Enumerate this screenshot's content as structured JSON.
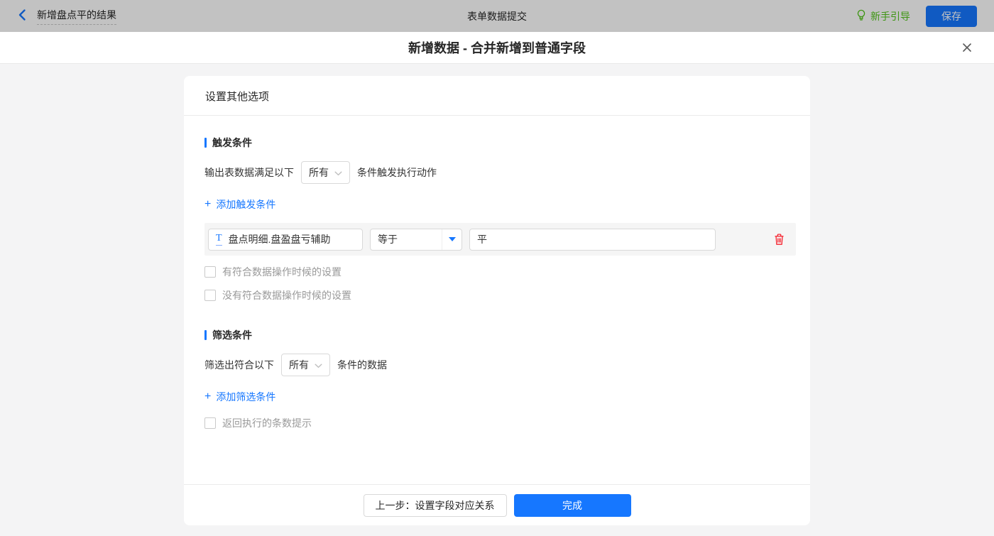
{
  "topbar": {
    "back_title": "新增盘点平的结果",
    "center_title": "表单数据提交",
    "guide_label": "新手引导",
    "save_label": "保存"
  },
  "modal": {
    "title": "新增数据 - 合并新增到普通字段"
  },
  "card": {
    "header_title": "设置其他选项",
    "trigger": {
      "title": "触发条件",
      "sentence_prefix": "输出表数据满足以下",
      "select_value": "所有",
      "sentence_suffix": "条件触发执行动作",
      "add_label": "添加触发条件",
      "condition": {
        "field": "盘点明细.盘盈盘亏辅助",
        "operator": "等于",
        "value": "平"
      },
      "options": [
        "有符合数据操作时候的设置",
        "没有符合数据操作时候的设置"
      ]
    },
    "filter": {
      "title": "筛选条件",
      "sentence_prefix": "筛选出符合以下",
      "select_value": "所有",
      "sentence_suffix": "条件的数据",
      "add_label": "添加筛选条件",
      "option": "返回执行的条数提示"
    }
  },
  "footer": {
    "prev_label": "上一步：设置字段对应关系",
    "done_label": "完成"
  },
  "icons": {
    "plus": "+",
    "text_type": "T"
  },
  "colors": {
    "accent_blue": "#1677ff",
    "guide_green": "#52c41a",
    "danger_red": "#f5222d",
    "dim_overlay": "rgba(0,0,0,0.24)"
  }
}
